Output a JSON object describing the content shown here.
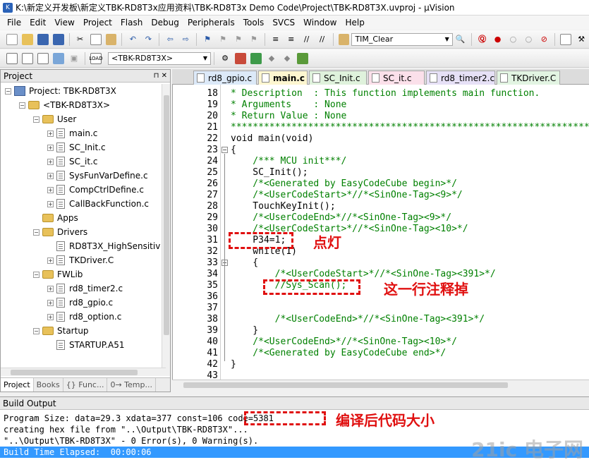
{
  "window": {
    "title": "K:\\新定义开发板\\新定义TBK-RD8T3x应用资料\\TBK-RD8T3x Demo Code\\Project\\TBK-RD8T3X.uvproj - µVision"
  },
  "menu": [
    "File",
    "Edit",
    "View",
    "Project",
    "Flash",
    "Debug",
    "Peripherals",
    "Tools",
    "SVCS",
    "Window",
    "Help"
  ],
  "toolbar": {
    "find_value": "TIM_Clear",
    "target_value": "<TBK-RD8T3X>"
  },
  "project_panel": {
    "title": "Project",
    "tree": [
      {
        "label": "Project: TBK-RD8T3X",
        "kind": "project",
        "level": 0
      },
      {
        "label": "<TBK-RD8T3X>",
        "kind": "target",
        "level": 1
      },
      {
        "label": "User",
        "kind": "folder",
        "level": 2
      },
      {
        "label": "main.c",
        "kind": "file",
        "level": 3
      },
      {
        "label": "SC_Init.c",
        "kind": "file",
        "level": 3
      },
      {
        "label": "SC_it.c",
        "kind": "file",
        "level": 3
      },
      {
        "label": "SysFunVarDefine.c",
        "kind": "file",
        "level": 3
      },
      {
        "label": "CompCtrlDefine.c",
        "kind": "file",
        "level": 3
      },
      {
        "label": "CallBackFunction.c",
        "kind": "file",
        "level": 3
      },
      {
        "label": "Apps",
        "kind": "folder",
        "level": 2
      },
      {
        "label": "Drivers",
        "kind": "folder",
        "level": 2
      },
      {
        "label": "RD8T3X_HighSensitiv",
        "kind": "file",
        "level": 3
      },
      {
        "label": "TKDriver.C",
        "kind": "file",
        "level": 3
      },
      {
        "label": "FWLib",
        "kind": "folder",
        "level": 2
      },
      {
        "label": "rd8_timer2.c",
        "kind": "file",
        "level": 3
      },
      {
        "label": "rd8_gpio.c",
        "kind": "file",
        "level": 3
      },
      {
        "label": "rd8_option.c",
        "kind": "file",
        "level": 3
      },
      {
        "label": "Startup",
        "kind": "folder",
        "level": 2
      },
      {
        "label": "STARTUP.A51",
        "kind": "file",
        "level": 3
      }
    ],
    "tabs": [
      "Project",
      "Books",
      "{} Func...",
      "0→ Temp..."
    ]
  },
  "editor": {
    "tabs": [
      "rd8_gpio.c",
      "main.c",
      "SC_Init.c",
      "SC_it.c",
      "rd8_timer2.c",
      "TKDriver.C"
    ],
    "active_tab": "main.c",
    "lines": [
      {
        "n": "18",
        "text": "* Description  : This function implements main function.",
        "style": "cmt"
      },
      {
        "n": "19",
        "text": "* Arguments    : None",
        "style": "cmt"
      },
      {
        "n": "20",
        "text": "* Return Value : None",
        "style": "cmt"
      },
      {
        "n": "21",
        "text": "*****************************************************************",
        "style": "cmt"
      },
      {
        "n": "22",
        "text": "void main(void)",
        "style": "plain"
      },
      {
        "n": "23",
        "text": "{",
        "style": "plain"
      },
      {
        "n": "24",
        "text": "    /*** MCU init***/",
        "style": "cmt"
      },
      {
        "n": "25",
        "text": "    SC_Init();",
        "style": "plain"
      },
      {
        "n": "26",
        "text": "    /*<Generated by EasyCodeCube begin>*/",
        "style": "cmt"
      },
      {
        "n": "27",
        "text": "    /*<UserCodeStart>*//*<SinOne-Tag><9>*/",
        "style": "cmt"
      },
      {
        "n": "28",
        "text": "    TouchKeyInit();",
        "style": "plain"
      },
      {
        "n": "29",
        "text": "    /*<UserCodeEnd>*//*<SinOne-Tag><9>*/",
        "style": "cmt"
      },
      {
        "n": "30",
        "text": "    /*<UserCodeStart>*//*<SinOne-Tag><10>*/",
        "style": "cmt"
      },
      {
        "n": "31",
        "text": "    P34=1;",
        "style": "plain"
      },
      {
        "n": "32",
        "text": "    while(1)",
        "style": "plain"
      },
      {
        "n": "33",
        "text": "    {",
        "style": "plain"
      },
      {
        "n": "34",
        "text": "        /*<UserCodeStart>*//*<SinOne-Tag><391>*/",
        "style": "cmt"
      },
      {
        "n": "35",
        "text": "        //Sys_Scan();",
        "style": "cmt"
      },
      {
        "n": "36",
        "text": "",
        "style": "plain"
      },
      {
        "n": "37",
        "text": "",
        "style": "plain"
      },
      {
        "n": "38",
        "text": "        /*<UserCodeEnd>*//*<SinOne-Tag><391>*/",
        "style": "cmt"
      },
      {
        "n": "39",
        "text": "    }",
        "style": "plain"
      },
      {
        "n": "40",
        "text": "    /*<UserCodeEnd>*//*<SinOne-Tag><10>*/",
        "style": "cmt"
      },
      {
        "n": "41",
        "text": "    /*<Generated by EasyCodeCube end>*/",
        "style": "cmt"
      },
      {
        "n": "42",
        "text": "}",
        "style": "plain"
      },
      {
        "n": "43",
        "text": "",
        "style": "plain"
      }
    ]
  },
  "build_output": {
    "title": "Build Output",
    "lines": [
      "Program Size: data=29.3 xdata=377 const=106 code=5381",
      "creating hex file from \"..\\Output\\TBK-RD8T3X\"...",
      "\"..\\Output\\TBK-RD8T3X\" - 0 Error(s), 0 Warning(s).",
      "Build Time Elapsed:  00:00:06"
    ]
  },
  "annotations": {
    "light": "点灯",
    "comment_out": "这一行注释掉",
    "code_size": "编译后代码大小"
  },
  "watermark": "21ic 电子网",
  "colors": {
    "comment": "#008000",
    "annotation": "#e01010",
    "active_tab": "#fdf6d0",
    "selection": "#3399ff"
  }
}
